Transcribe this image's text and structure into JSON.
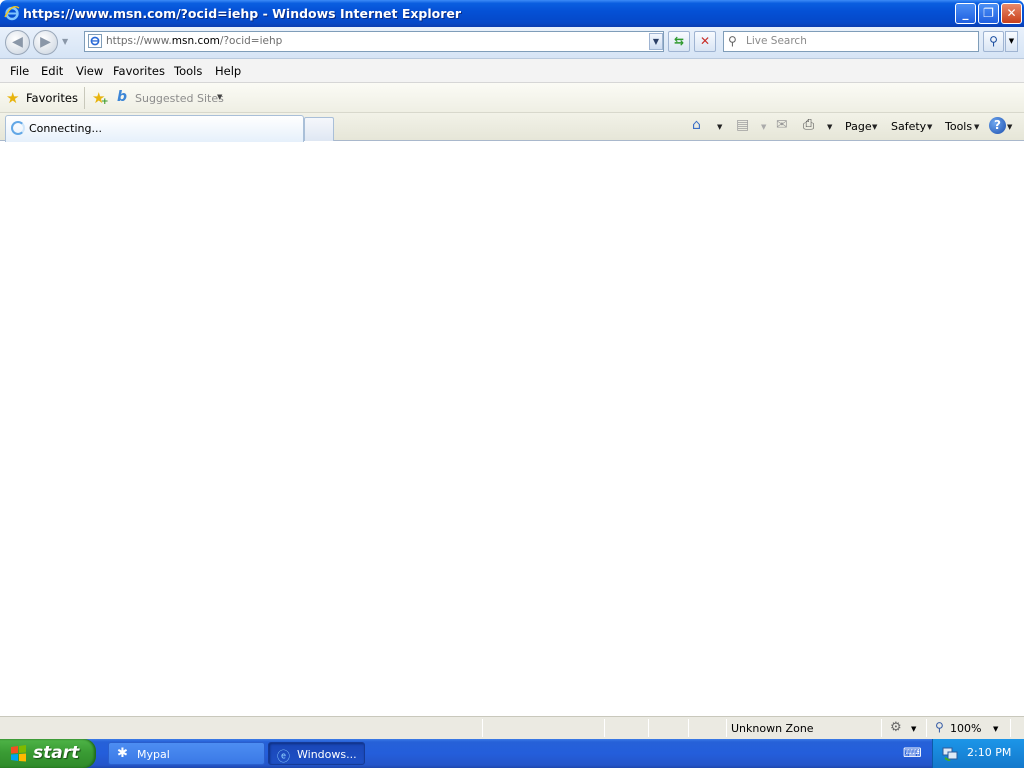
{
  "window": {
    "title": "https://www.msn.com/?ocid=iehp - Windows Internet Explorer",
    "min_label": "_",
    "restore_label": "❐",
    "close_label": "✕"
  },
  "address": {
    "prefix": "https://www.",
    "domain": "msn.com",
    "suffix": "/?ocid=iehp"
  },
  "search": {
    "placeholder": "Live Search"
  },
  "menu": [
    "File",
    "Edit",
    "View",
    "Favorites",
    "Tools",
    "Help"
  ],
  "favorites_bar": {
    "favorites_label": "Favorites",
    "suggested_label": "Suggested Sites"
  },
  "tab": {
    "label": "Connecting..."
  },
  "command_bar": {
    "page_label": "Page",
    "safety_label": "Safety",
    "tools_label": "Tools",
    "help_glyph": "?"
  },
  "status": {
    "zone": "Unknown Zone",
    "zoom": "100%"
  },
  "taskbar": {
    "start_label": "start",
    "tasks": [
      {
        "label": "Mypal"
      },
      {
        "label": "Windows..."
      }
    ],
    "clock": "2:10 PM"
  },
  "colors": {
    "titlebar": "#0551d6",
    "taskbar": "#245edb",
    "start_button": "#3a9c34",
    "tray": "#1c96e8"
  }
}
